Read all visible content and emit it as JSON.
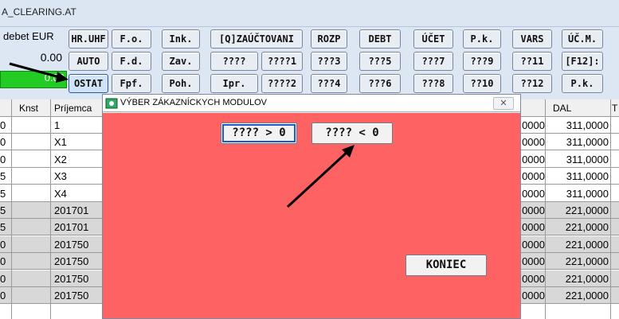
{
  "window": {
    "title": "A_CLEARING.AT"
  },
  "toolbar": {
    "debet_label": "debet EUR",
    "amount_value": "0.00",
    "green_value": "0.00",
    "row1": [
      "HR.UHF",
      "F.o.",
      "Ink.",
      "[Q]ZAÚČTOVANI",
      "ROZP",
      "DEBT",
      "ÚČET",
      "P.k.",
      "VARS",
      "ÚČ.M."
    ],
    "row2": [
      "AUTO",
      "F.d.",
      "Zav.",
      "????",
      "????1",
      "???3",
      "???5",
      "???7",
      "???9",
      "??11",
      "[F12]:"
    ],
    "row3": [
      "OSTAT",
      "Fpf.",
      "Poh.",
      "Ipr.",
      "????2",
      "???4",
      "???6",
      "???8",
      "??10",
      "??12",
      "P.k."
    ]
  },
  "grid": {
    "headers": {
      "knst": "Knst",
      "prijemca": "Príjemca",
      "dal": "DAL",
      "last": "T"
    },
    "rows": [
      {
        "knst": "0",
        "prijemca": "1",
        "num1": "0000",
        "num2": "311,0000",
        "shade": false
      },
      {
        "knst": "0",
        "prijemca": "X1",
        "num1": "0000",
        "num2": "311,0000",
        "shade": false
      },
      {
        "knst": "0",
        "prijemca": "X2",
        "num1": "0000",
        "num2": "311,0000",
        "shade": false
      },
      {
        "knst": "5",
        "prijemca": "X3",
        "num1": "0000",
        "num2": "311,0000",
        "shade": false
      },
      {
        "knst": "5",
        "prijemca": "X4",
        "num1": "0000",
        "num2": "311,0000",
        "shade": false
      },
      {
        "knst": "5",
        "prijemca": "201701",
        "num1": "0000",
        "num2": "221,0000",
        "shade": true
      },
      {
        "knst": "5",
        "prijemca": "201701",
        "num1": "0000",
        "num2": "221,0000",
        "shade": true
      },
      {
        "knst": "0",
        "prijemca": "201750",
        "num1": "0000",
        "num2": "221,0000",
        "shade": true
      },
      {
        "knst": "0",
        "prijemca": "201750",
        "num1": "0000",
        "num2": "221,0000",
        "shade": true
      },
      {
        "knst": "0",
        "prijemca": "201750",
        "num1": "0000",
        "num2": "221,0000",
        "shade": true
      },
      {
        "knst": "0",
        "prijemca": "201750",
        "num1": "0000",
        "num2": "221,0000",
        "shade": true
      }
    ]
  },
  "modal": {
    "title": "VÝBER ZÁKAZNÍCKYCH MODULOV",
    "close_glyph": "✕",
    "btn_positive": "???? > 0",
    "btn_negative": "???? < 0",
    "btn_end": "KONIEC",
    "body_color": "#ff6262"
  }
}
